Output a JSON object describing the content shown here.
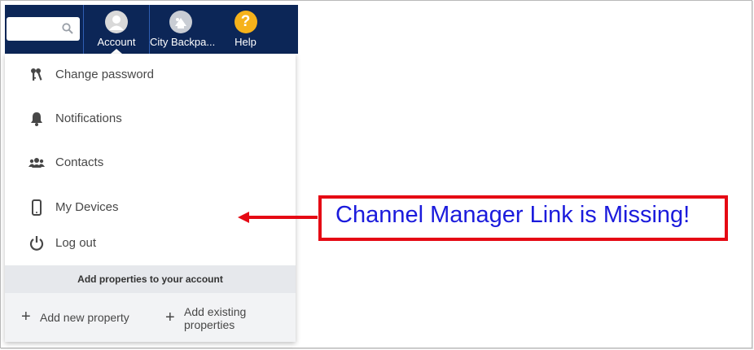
{
  "search": {
    "placeholder": "",
    "icon": "search-icon"
  },
  "nav": {
    "account_label": "Account",
    "property_label": "City Backpa...",
    "help_label": "Help",
    "help_glyph": "?"
  },
  "menu": {
    "items": [
      {
        "label": "Change password",
        "icon": "keys-icon"
      },
      {
        "label": "Notifications",
        "icon": "bell-icon"
      },
      {
        "label": "Contacts",
        "icon": "users-icon"
      },
      {
        "label": "My Devices",
        "icon": "mobile-device-icon"
      },
      {
        "label": "Log out",
        "icon": "power-icon"
      }
    ]
  },
  "add_properties": {
    "header": "Add properties to your account",
    "add_new_label": "Add new property",
    "add_existing_line1": "Add existing",
    "add_existing_line2": "properties"
  },
  "annotation": {
    "text": "Channel Manager Link is Missing!",
    "border_color": "#e50914",
    "text_color": "#1b1bdc"
  },
  "colors": {
    "navbar": "#0c2657",
    "help_badge": "#f6b21b"
  }
}
